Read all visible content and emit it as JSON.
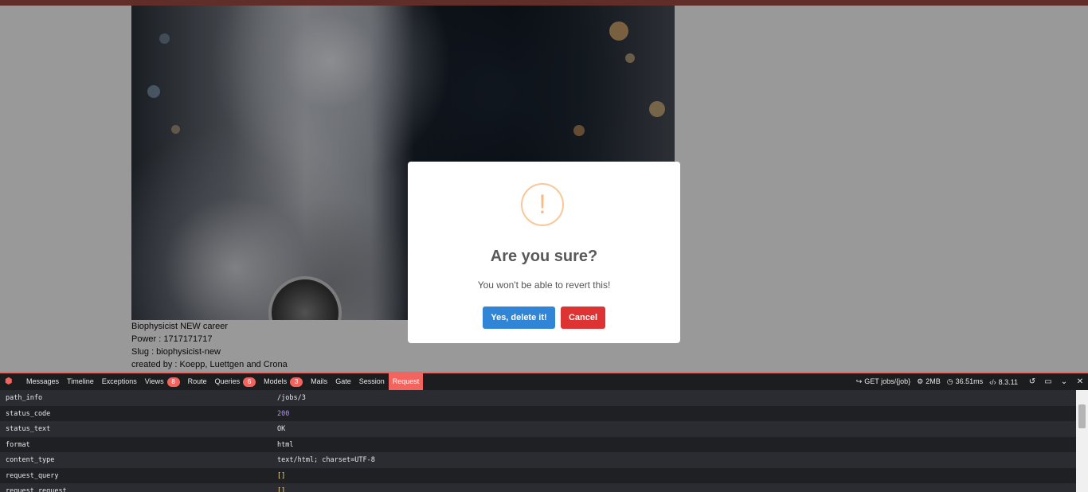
{
  "job": {
    "title": "Biophysicist NEW career",
    "power": "Power : 1717171717",
    "slug": "Slug : biophysicist-new",
    "created_by": "created by : Koepp, Luettgen and Crona"
  },
  "dialog": {
    "icon": "!",
    "title": "Are you sure?",
    "text": "You won't be able to revert this!",
    "confirm_label": "Yes, delete it!",
    "cancel_label": "Cancel",
    "confirm_color": "#3085d6",
    "cancel_color": "#dd3333"
  },
  "debugbar": {
    "accent": "#f4645f",
    "tabs": [
      {
        "label": "Messages"
      },
      {
        "label": "Timeline"
      },
      {
        "label": "Exceptions"
      },
      {
        "label": "Views",
        "badge": "8"
      },
      {
        "label": "Route"
      },
      {
        "label": "Queries",
        "badge": "6"
      },
      {
        "label": "Models",
        "badge": "3"
      },
      {
        "label": "Mails"
      },
      {
        "label": "Gate"
      },
      {
        "label": "Session"
      },
      {
        "label": "Request",
        "active": true
      }
    ],
    "route": "GET jobs/{job}",
    "memory": "2MB",
    "time": "36.51ms",
    "php_version": "8.3.11",
    "rows": [
      {
        "key": "path_info",
        "value": "/jobs/3"
      },
      {
        "key": "status_code",
        "value": "200"
      },
      {
        "key": "status_text",
        "value": "OK"
      },
      {
        "key": "format",
        "value": "html"
      },
      {
        "key": "content_type",
        "value": "text/html; charset=UTF-8"
      },
      {
        "key": "request_query",
        "value": "[]"
      },
      {
        "key": "request_request",
        "value": "[]"
      }
    ]
  }
}
